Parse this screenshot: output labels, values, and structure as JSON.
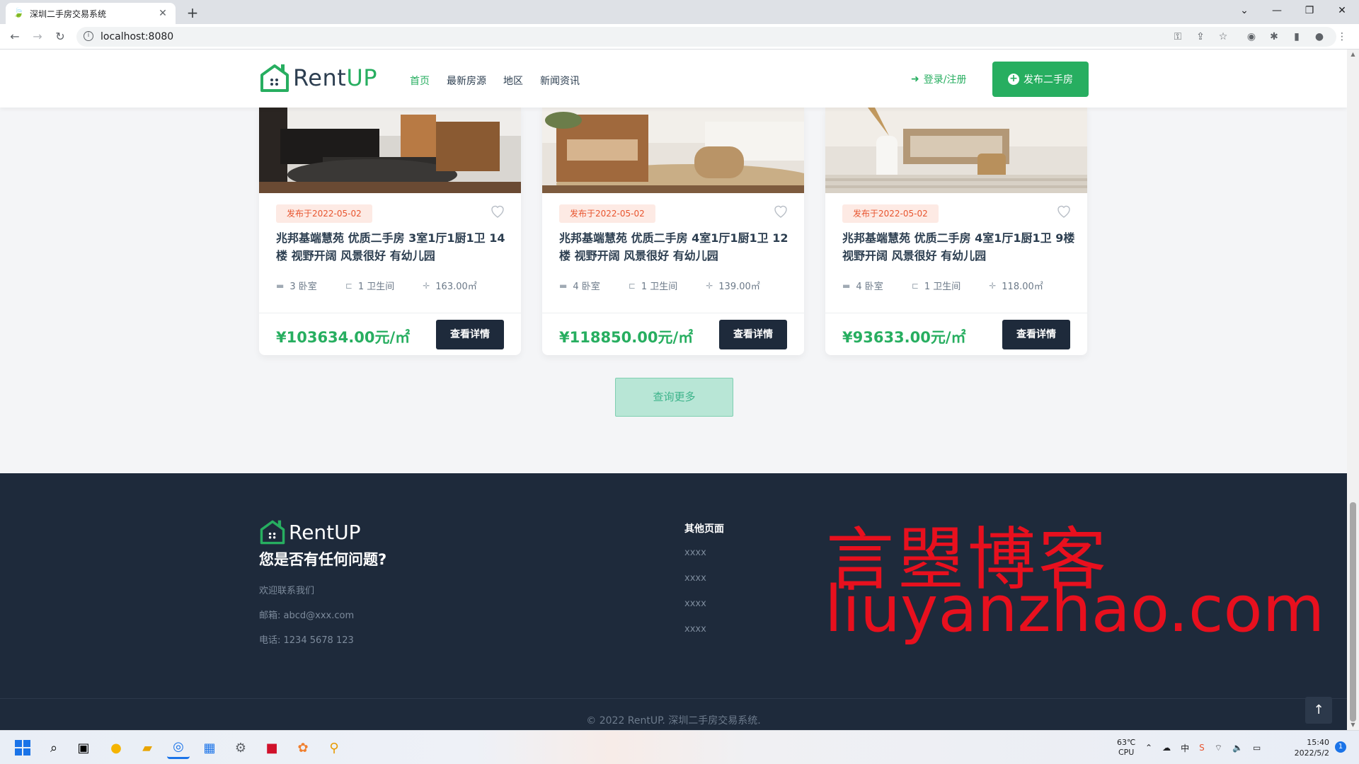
{
  "browser": {
    "tab_title": "深圳二手房交易系统",
    "url": "localhost:8080"
  },
  "header": {
    "logo_prefix": "Rent",
    "logo_suffix": "UP",
    "nav": [
      "首页",
      "最新房源",
      "地区",
      "新闻资讯"
    ],
    "active_nav": 0,
    "login_label": "登录/注册",
    "post_label": "发布二手房"
  },
  "listings": [
    {
      "date": "发布于2022-05-02",
      "title": "兆邦基端慧苑 优质二手房 3室1厅1厨1卫 14楼 视野开阔 风景很好 有幼儿园",
      "beds": "3 卧室",
      "baths": "1 卫生间",
      "area": "163.00㎡",
      "price": "¥103634.00元/㎡",
      "button": "查看详情"
    },
    {
      "date": "发布于2022-05-02",
      "title": "兆邦基端慧苑 优质二手房 4室1厅1厨1卫 12楼 视野开阔 风景很好 有幼儿园",
      "beds": "4 卧室",
      "baths": "1 卫生间",
      "area": "139.00㎡",
      "price": "¥118850.00元/㎡",
      "button": "查看详情"
    },
    {
      "date": "发布于2022-05-02",
      "title": "兆邦基端慧苑 优质二手房 4室1厅1厨1卫 9楼 视野开阔 风景很好 有幼儿园",
      "beds": "4 卧室",
      "baths": "1 卫生间",
      "area": "118.00㎡",
      "price": "¥93633.00元/㎡",
      "button": "查看详情"
    }
  ],
  "more_button": "查询更多",
  "footer": {
    "logo_text": "RentUP",
    "question": "您是否有任何问题?",
    "welcome": "欢迎联系我们",
    "email": "邮箱:  abcd@xxx.com",
    "phone": "电话:  1234 5678 123",
    "other_pages_heading": "其他页面",
    "links": [
      "xxxx",
      "xxxx",
      "xxxx",
      "xxxx"
    ],
    "watermark_cn": "言曌博客",
    "watermark_en": "liuyanzhao.com",
    "copyright": "© 2022 RentUP. 深圳二手房交易系统."
  },
  "taskbar": {
    "temp": "63℃",
    "cpu": "CPU",
    "time": "15:40",
    "date": "2022/5/2",
    "badge": "1"
  },
  "colors": {
    "brand_green": "#27ae60",
    "dark_navy": "#1e2a3b",
    "badge_bg": "#fdeae4",
    "badge_text": "#e8552f",
    "watermark_red": "#e8101e"
  }
}
